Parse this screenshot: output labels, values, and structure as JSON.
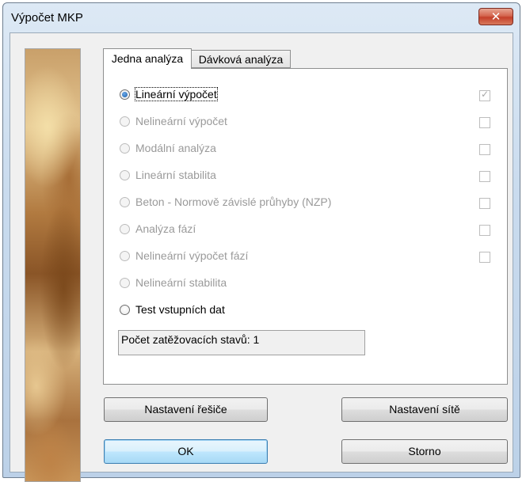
{
  "window": {
    "title": "Výpočet MKP",
    "close_glyph": "✕"
  },
  "tabs": [
    {
      "label": "Jedna analýza",
      "active": true
    },
    {
      "label": "Dávková analýza",
      "active": false
    }
  ],
  "options": [
    {
      "label": "Lineární výpočet",
      "selected": true,
      "enabled": true,
      "checkbox_checked": true
    },
    {
      "label": "Nelineární výpočet",
      "selected": false,
      "enabled": false,
      "checkbox_checked": false
    },
    {
      "label": "Modální analýza",
      "selected": false,
      "enabled": false,
      "checkbox_checked": false
    },
    {
      "label": "Lineární stabilita",
      "selected": false,
      "enabled": false,
      "checkbox_checked": false
    },
    {
      "label": "Beton - Normově závislé průhyby (NZP)",
      "selected": false,
      "enabled": false,
      "checkbox_checked": false
    },
    {
      "label": "Analýza fází",
      "selected": false,
      "enabled": false,
      "checkbox_checked": false
    },
    {
      "label": "Nelineární výpočet fází",
      "selected": false,
      "enabled": false,
      "checkbox_checked": false
    },
    {
      "label": "Nelineární stabilita",
      "selected": false,
      "enabled": false
    },
    {
      "label": "Test vstupních dat",
      "selected": false,
      "enabled": true
    }
  ],
  "status": {
    "text": "Počet zatěžovacích stavů: 1"
  },
  "buttons": {
    "solver_settings": "Nastavení řešiče",
    "mesh_settings": "Nastavení sítě",
    "ok": "OK",
    "cancel": "Storno"
  },
  "checkmark_glyph": "✓"
}
